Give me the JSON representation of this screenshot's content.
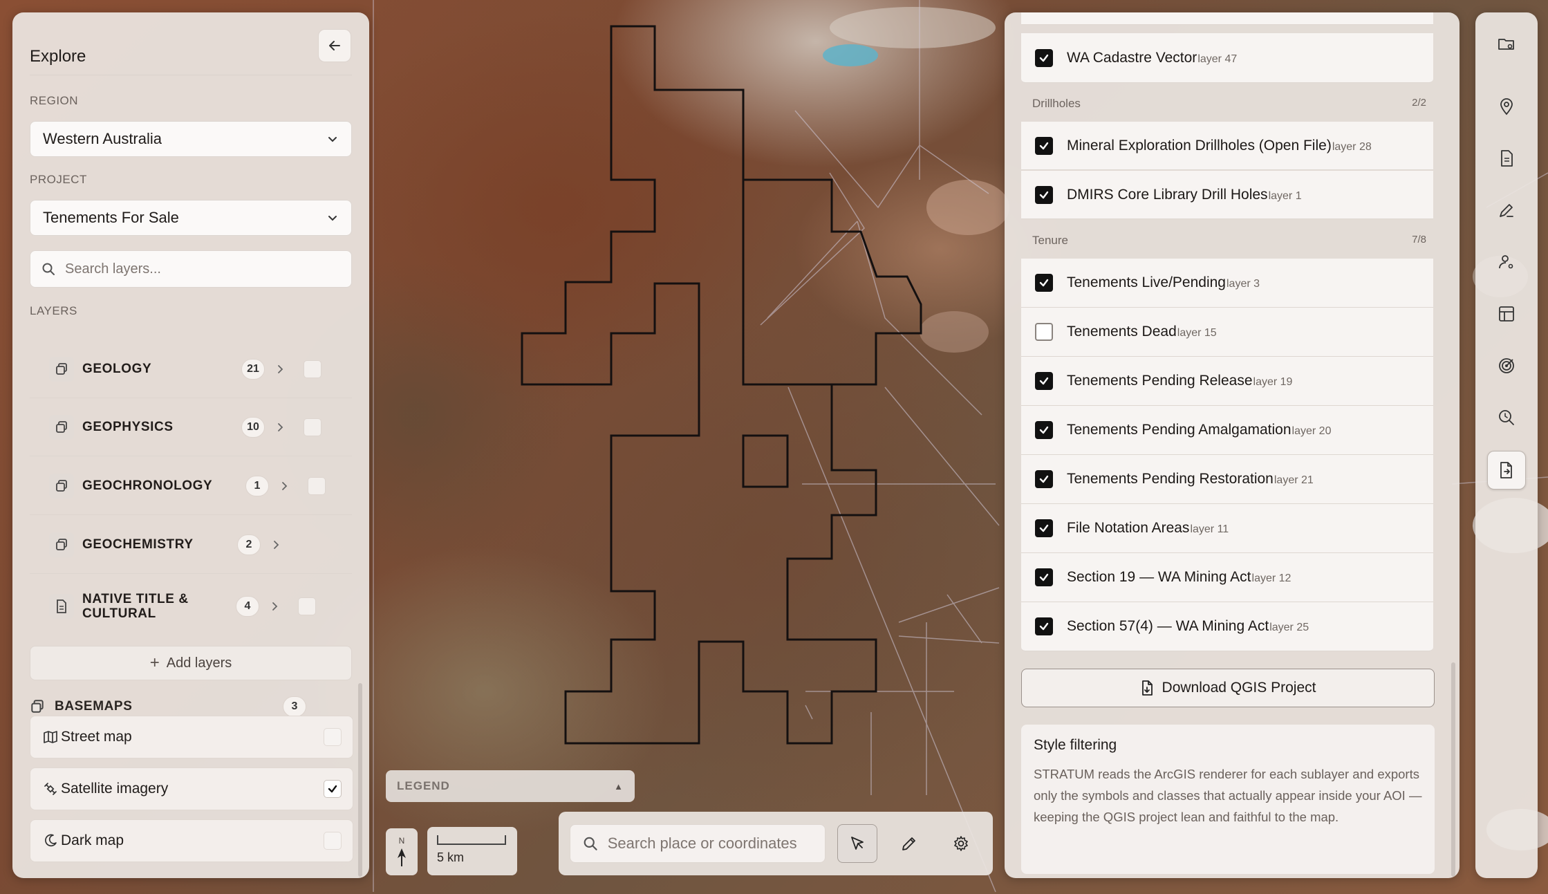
{
  "map": {
    "north_label": "N",
    "scale_label": "5 km",
    "legend_label": "LEGEND",
    "search_placeholder": "Search place or coordinates"
  },
  "sidebar": {
    "title": "Explore",
    "region_label": "REGION",
    "region_value": "Western Australia",
    "project_label": "PROJECT",
    "project_value": "Tenements For Sale",
    "search_placeholder": "Search layers...",
    "layers_label": "LAYERS",
    "layers": [
      {
        "name": "GEOLOGY",
        "count": "21",
        "icon": "layers-icon"
      },
      {
        "name": "GEOPHYSICS",
        "count": "10",
        "icon": "layers-icon"
      },
      {
        "name": "GEOCHRONOLOGY",
        "count": "1",
        "icon": "layers-icon"
      },
      {
        "name": "GEOCHEMISTRY",
        "count": "2",
        "icon": "layers-icon"
      },
      {
        "name": "NATIVE TITLE & CULTURAL",
        "count": "4",
        "icon": "document-icon"
      }
    ],
    "add_layers_label": "Add layers",
    "basemaps_label": "BASEMAPS",
    "basemaps_count": "3",
    "basemaps": [
      {
        "name": "Street map",
        "checked": false,
        "icon": "map-icon"
      },
      {
        "name": "Satellite imagery",
        "checked": true,
        "icon": "satellite-icon"
      },
      {
        "name": "Dark map",
        "checked": false,
        "icon": "moon-icon"
      }
    ]
  },
  "layer_list": {
    "top_items": [
      {
        "name": "WA Cadastre Vector",
        "sub": "layer 47",
        "checked": true
      }
    ],
    "groups": [
      {
        "name": "Drillholes",
        "count": "2/2",
        "items": [
          {
            "name": "Mineral Exploration Drillholes (Open File)",
            "sub": "layer 28",
            "checked": true
          },
          {
            "name": "DMIRS Core Library Drill Holes",
            "sub": "layer 1",
            "checked": true
          }
        ]
      },
      {
        "name": "Tenure",
        "count": "7/8",
        "items": [
          {
            "name": "Tenements Live/Pending",
            "sub": "layer 3",
            "checked": true
          },
          {
            "name": "Tenements Dead",
            "sub": "layer 15",
            "checked": false
          },
          {
            "name": "Tenements Pending Release",
            "sub": "layer 19",
            "checked": true
          },
          {
            "name": "Tenements Pending Amalgamation",
            "sub": "layer 20",
            "checked": true
          },
          {
            "name": "Tenements Pending Restoration",
            "sub": "layer 21",
            "checked": true
          },
          {
            "name": "File Notation Areas",
            "sub": "layer 11",
            "checked": true
          },
          {
            "name": "Section 19 — WA Mining Act",
            "sub": "layer 12",
            "checked": true
          },
          {
            "name": "Section 57(4) — WA Mining Act",
            "sub": "layer 25",
            "checked": true
          }
        ]
      }
    ],
    "download_label": "Download QGIS Project",
    "style_title": "Style filtering",
    "style_body": "STRATUM reads the ArcGIS renderer for each sublayer and exports only the symbols and classes that actually appear inside your AOI — keeping the QGIS project lean and faithful to the map."
  },
  "tool_rail": [
    {
      "icon": "folder-settings-icon",
      "active": false
    },
    {
      "icon": "location-pin-icon",
      "active": false
    },
    {
      "icon": "document-icon",
      "active": false
    },
    {
      "icon": "draw-pen-icon",
      "active": false
    },
    {
      "icon": "user-settings-icon",
      "active": false
    },
    {
      "icon": "table-icon",
      "active": false
    },
    {
      "icon": "target-icon",
      "active": false
    },
    {
      "icon": "search-history-icon",
      "active": false
    },
    {
      "icon": "file-export-icon",
      "active": true
    }
  ],
  "map_tools": [
    {
      "icon": "pointer-icon",
      "active": true
    },
    {
      "icon": "pencil-icon",
      "active": false
    },
    {
      "icon": "gear-icon",
      "active": false
    }
  ]
}
